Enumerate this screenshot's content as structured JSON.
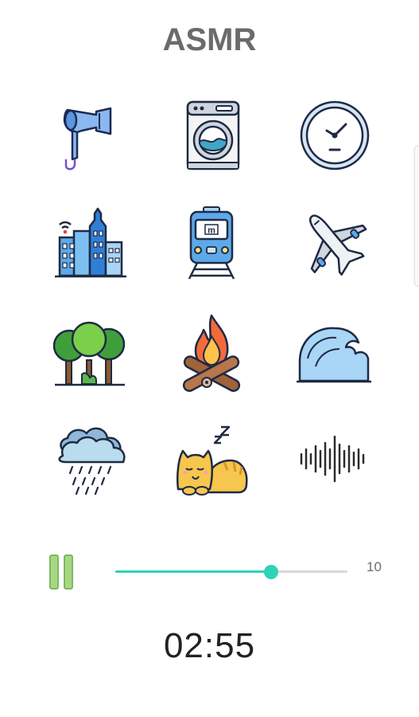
{
  "app": {
    "title": "ASMR"
  },
  "sounds": [
    {
      "icon": "hair-dryer-icon"
    },
    {
      "icon": "washing-machine-icon"
    },
    {
      "icon": "clock-icon"
    },
    {
      "icon": "city-buildings-icon"
    },
    {
      "icon": "metro-train-icon"
    },
    {
      "icon": "airplane-icon"
    },
    {
      "icon": "forest-trees-icon"
    },
    {
      "icon": "campfire-icon"
    },
    {
      "icon": "ocean-wave-icon"
    },
    {
      "icon": "rain-cloud-icon"
    },
    {
      "icon": "sleeping-cat-icon"
    },
    {
      "icon": "sound-wave-icon"
    }
  ],
  "player": {
    "state": "playing",
    "volume": {
      "value": 6.7,
      "max": 10,
      "max_label": "10"
    },
    "timer": "02:55"
  },
  "colors": {
    "accent": "#2ed3b9",
    "pause": "#a6d882",
    "title": "#6b6b6b"
  }
}
